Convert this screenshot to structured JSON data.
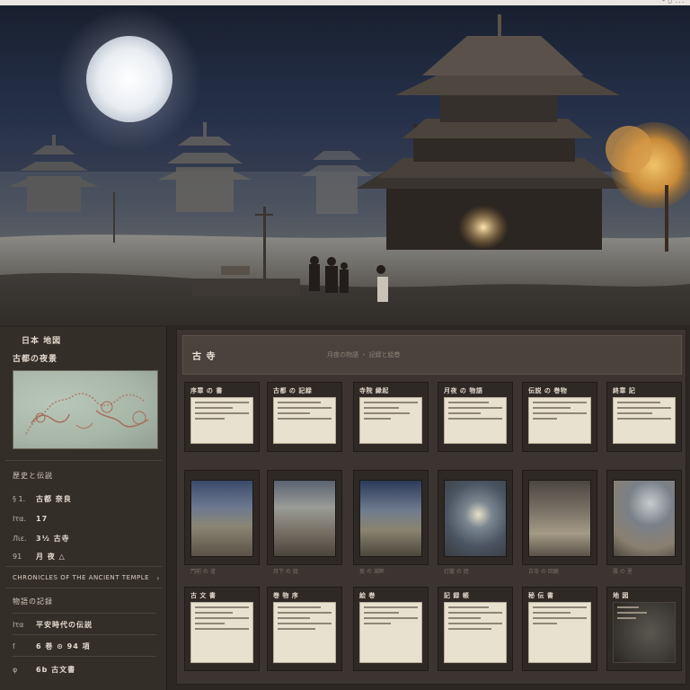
{
  "topbar": {
    "corner": "* □ ..."
  },
  "sidebar": {
    "title": "日本 地図",
    "subtitle": "古都の夜景",
    "section1": "歴史と伝説",
    "rows": [
      {
        "key": "§ 1.",
        "value": "古都 奈良"
      },
      {
        "key": "Ιτα.",
        "value": "17"
      },
      {
        "key": "Лιε.",
        "value": "3½ 古寺"
      },
      {
        "key": "91",
        "value": "月 夜 △"
      }
    ],
    "link1": "CHRONICLES OF THE ANCIENT TEMPLE",
    "section2": "物語の記録",
    "rows2": [
      {
        "key": "Ιτα",
        "value": "平安時代の伝説"
      },
      {
        "key": "ſ",
        "value": "6 巻 ⊙ 94 項"
      },
      {
        "key": "φ",
        "value": "6b 古文書"
      }
    ]
  },
  "main": {
    "header_title": "古 寺",
    "header_sub": "月夜の物語 ・ 記録と絵巻",
    "doc_cards": [
      "序章 の 書",
      "古都 の 記録",
      "寺院 縁起",
      "月夜 の 物語",
      "伝説 の 巻物",
      "終章 記"
    ],
    "image_cards": [
      "門前 の 道",
      "月下 の 庭",
      "夜 の 湖畔",
      "灯籠 の 庭",
      "古寺 の 回廊",
      "霧 の 里"
    ],
    "bottom_cards": [
      "古 文 書",
      "巻 物 序",
      "絵 巻",
      "記 録 帳",
      "秘 伝 書",
      "地 図"
    ]
  }
}
